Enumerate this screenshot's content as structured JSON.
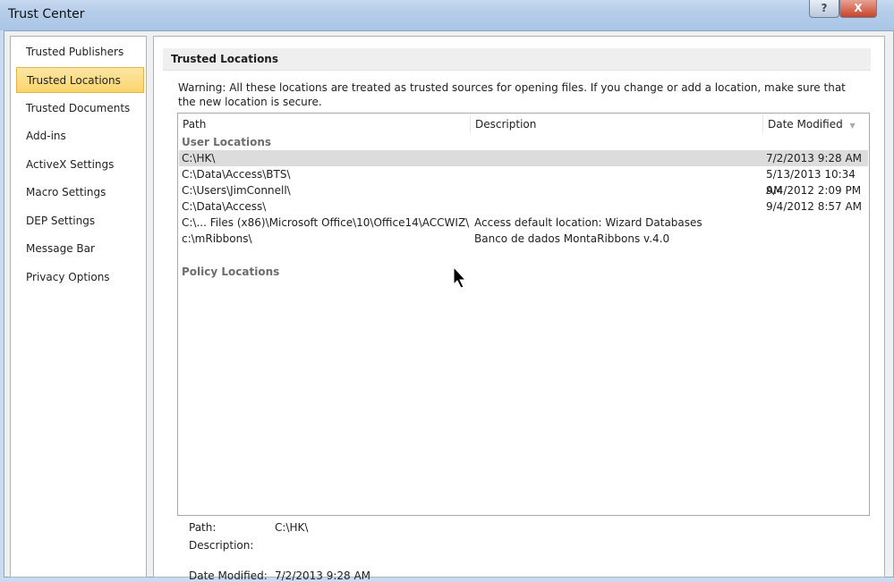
{
  "window": {
    "title": "Trust Center",
    "help_label": "?",
    "close_label": "X"
  },
  "sidebar": {
    "items": [
      {
        "label": "Trusted Publishers"
      },
      {
        "label": "Trusted Locations",
        "active": true
      },
      {
        "label": "Trusted Documents"
      },
      {
        "label": "Add-ins"
      },
      {
        "label": "ActiveX Settings"
      },
      {
        "label": "Macro Settings"
      },
      {
        "label": "DEP Settings"
      },
      {
        "label": "Message Bar"
      },
      {
        "label": "Privacy Options"
      }
    ]
  },
  "main": {
    "section_title": "Trusted Locations",
    "warning": "Warning: All these locations are treated as trusted sources for opening files.  If you change or add a location, make sure that the new location is secure.",
    "columns": {
      "path": "Path",
      "description": "Description",
      "date": "Date Modified",
      "sort_icon": "▼"
    },
    "user_group": "User Locations",
    "policy_group": "Policy Locations",
    "rows": [
      {
        "path": "C:\\HK\\",
        "description": "",
        "date": "7/2/2013 9:28 AM"
      },
      {
        "path": "C:\\Data\\Access\\BTS\\",
        "description": "",
        "date": "5/13/2013 10:34 AM"
      },
      {
        "path": "C:\\Users\\JimConnell\\",
        "description": "",
        "date": "9/4/2012 2:09 PM"
      },
      {
        "path": "C:\\Data\\Access\\",
        "description": "",
        "date": "9/4/2012 8:57 AM"
      },
      {
        "path": "C:\\... Files (x86)\\Microsoft Office\\10\\Office14\\ACCWIZ\\",
        "description": "Access default location: Wizard Databases",
        "date": ""
      },
      {
        "path": "c:\\mRibbons\\",
        "description": "Banco de dados MontaRibbons v.4.0",
        "date": ""
      }
    ],
    "details": {
      "path_label": "Path:",
      "path_value": "C:\\HK\\",
      "description_label": "Description:",
      "description_value": "",
      "date_label": "Date Modified:",
      "date_value": "7/2/2013 9:28 AM"
    }
  }
}
